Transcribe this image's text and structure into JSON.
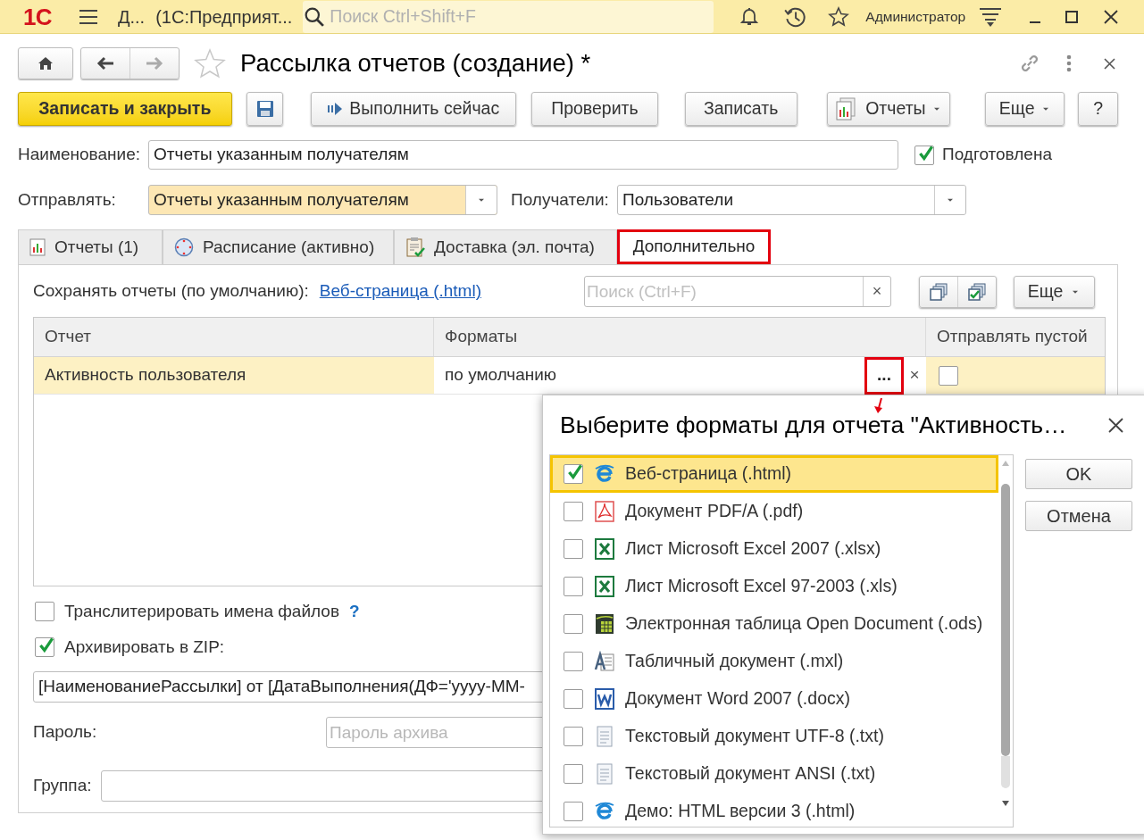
{
  "app_bar": {
    "logo": "1С",
    "title_short": "Д...",
    "title": "(1С:Предприят...",
    "search": {
      "placeholder": "Поиск Ctrl+Shift+F"
    },
    "user": "Администратор"
  },
  "form": {
    "title": "Рассылка отчетов (создание) *"
  },
  "toolbar": [
    {
      "kind": "primary",
      "label": "Записать и закрыть"
    },
    {
      "kind": "save"
    },
    {
      "kind": "run",
      "label": "Выполнить сейчас"
    },
    {
      "kind": "plain",
      "label": "Проверить"
    },
    {
      "kind": "plain",
      "label": "Записать"
    },
    {
      "kind": "reports",
      "label": "Отчеты"
    },
    {
      "kind": "menu",
      "label": "Еще"
    },
    {
      "kind": "plain",
      "label": "?"
    }
  ],
  "name_field": {
    "label": "Наименование:",
    "value": "Отчеты указанным получателям"
  },
  "prepared": {
    "label": "Подготовлена",
    "checked": true
  },
  "send": {
    "label": "Отправлять:",
    "value": "Отчеты указанным получателям"
  },
  "recipients": {
    "label": "Получатели:",
    "value": "Пользователи"
  },
  "tabs": [
    {
      "label": "Отчеты (1)",
      "kind": "chart",
      "selected": false
    },
    {
      "label": "Расписание (активно)",
      "kind": "clock",
      "selected": false
    },
    {
      "label": "Доставка (эл. почта)",
      "kind": "clipboard",
      "selected": false
    },
    {
      "label": "Дополнительно",
      "kind": "plain",
      "selected": true
    }
  ],
  "panel": {
    "save_label": "Сохранять отчеты (по умолчанию):",
    "save_link": "Веб-страница (.html)",
    "search": {
      "placeholder": "Поиск (Ctrl+F)",
      "clear": "×"
    },
    "more": "Еще"
  },
  "table": {
    "columns": [
      "Отчет",
      "Форматы",
      "Отправлять пустой"
    ],
    "rows": [
      {
        "report": "Активность пользователя",
        "formats": "по умолчанию",
        "choose": "...",
        "clear": "×",
        "send_empty": false,
        "selected": true
      }
    ]
  },
  "transliterate": {
    "label": "Транслитерировать имена файлов",
    "help": "?",
    "checked": false
  },
  "archive": {
    "label": "Архивировать в ZIP:",
    "checked": true
  },
  "archive_name": {
    "value": "[НаименованиеРассылки] от [ДатаВыполнения(ДФ='yyyy-MM-"
  },
  "password": {
    "label": "Пароль:",
    "placeholder": "Пароль архива"
  },
  "group": {
    "label": "Группа:"
  },
  "dialog": {
    "title": "Выберите форматы для отчета \"Активность…",
    "items": [
      {
        "label": "Веб-страница (.html)",
        "kind": "html",
        "checked": true,
        "selected": true
      },
      {
        "label": "Документ PDF/A (.pdf)",
        "kind": "pdf",
        "checked": false,
        "selected": false
      },
      {
        "label": "Лист Microsoft Excel 2007 (.xlsx)",
        "kind": "excel",
        "checked": false,
        "selected": false
      },
      {
        "label": "Лист Microsoft Excel 97-2003 (.xls)",
        "kind": "excel",
        "checked": false,
        "selected": false
      },
      {
        "label": "Электронная таблица Open Document (.ods)",
        "kind": "ods",
        "checked": false,
        "selected": false
      },
      {
        "label": "Табличный документ (.mxl)",
        "kind": "mxl",
        "checked": false,
        "selected": false
      },
      {
        "label": "Документ Word 2007 (.docx)",
        "kind": "word",
        "checked": false,
        "selected": false
      },
      {
        "label": "Текстовый документ UTF-8 (.txt)",
        "kind": "txt",
        "checked": false,
        "selected": false
      },
      {
        "label": "Текстовый документ ANSI (.txt)",
        "kind": "txt",
        "checked": false,
        "selected": false
      },
      {
        "label": "Демо: HTML версии 3 (.html)",
        "kind": "html",
        "checked": false,
        "selected": false
      }
    ],
    "buttons": [
      "OK",
      "Отмена"
    ]
  }
}
